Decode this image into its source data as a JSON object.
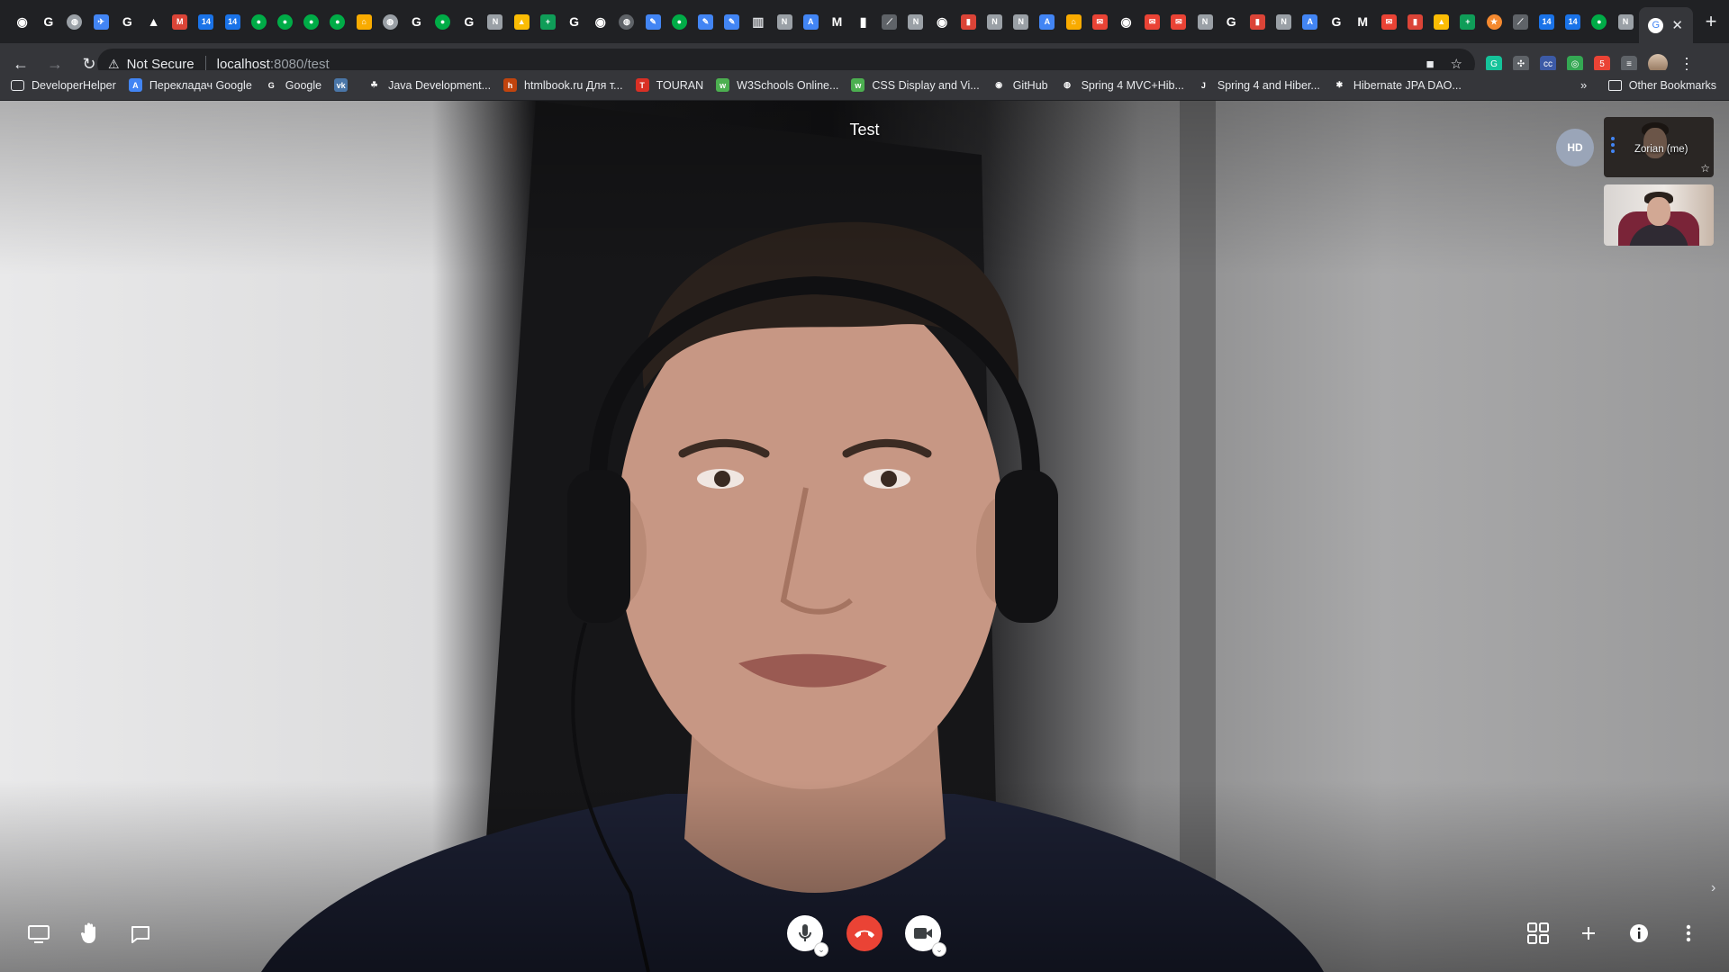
{
  "browser": {
    "tabs": [
      {
        "icon": "github-icon",
        "color": "#ffffff",
        "glyph": "◉"
      },
      {
        "icon": "google-icon",
        "color": "#ffffff",
        "glyph": "G"
      },
      {
        "icon": "globe-icon",
        "color": "#9aa0a6",
        "glyph": "◍"
      },
      {
        "icon": "bird-icon",
        "color": "#4285f4",
        "glyph": "✈"
      },
      {
        "icon": "google-icon",
        "color": "#ffffff",
        "glyph": "G"
      },
      {
        "icon": "flask-icon",
        "color": "#ffffff",
        "glyph": "▲"
      },
      {
        "icon": "app-icon",
        "color": "#db4437",
        "glyph": "M"
      },
      {
        "icon": "calendar-icon",
        "color": "#1a73e8",
        "glyph": "14"
      },
      {
        "icon": "calendar-icon",
        "color": "#1a73e8",
        "glyph": "14"
      },
      {
        "icon": "chat-icon",
        "color": "#00ac47",
        "glyph": "●"
      },
      {
        "icon": "chat-icon",
        "color": "#00ac47",
        "glyph": "●"
      },
      {
        "icon": "chat-icon",
        "color": "#00ac47",
        "glyph": "●"
      },
      {
        "icon": "chat-icon",
        "color": "#00ac47",
        "glyph": "●"
      },
      {
        "icon": "bridge-icon",
        "color": "#f9ab00",
        "glyph": "⌂"
      },
      {
        "icon": "globe-icon",
        "color": "#9aa0a6",
        "glyph": "◍"
      },
      {
        "icon": "google-icon",
        "color": "#ffffff",
        "glyph": "G"
      },
      {
        "icon": "chat-icon",
        "color": "#00ac47",
        "glyph": "●"
      },
      {
        "icon": "google-icon",
        "color": "#ffffff",
        "glyph": "G"
      },
      {
        "icon": "notion-icon",
        "color": "#9aa0a6",
        "glyph": "N"
      },
      {
        "icon": "drive-icon",
        "color": "#fbbc04",
        "glyph": "▲"
      },
      {
        "icon": "sheets-icon",
        "color": "#0f9d58",
        "glyph": "+"
      },
      {
        "icon": "google-icon",
        "color": "#ffffff",
        "glyph": "G"
      },
      {
        "icon": "github-icon",
        "color": "#ffffff",
        "glyph": "◉"
      },
      {
        "icon": "globe-icon",
        "color": "#5f6368",
        "glyph": "◍"
      },
      {
        "icon": "edit-icon",
        "color": "#4285f4",
        "glyph": "✎"
      },
      {
        "icon": "chat-icon",
        "color": "#00ac47",
        "glyph": "●"
      },
      {
        "icon": "edit-icon",
        "color": "#4285f4",
        "glyph": "✎"
      },
      {
        "icon": "edit-icon",
        "color": "#4285f4",
        "glyph": "✎"
      },
      {
        "icon": "trash-icon",
        "color": "#dadce0",
        "glyph": "▥"
      },
      {
        "icon": "notion-icon",
        "color": "#9aa0a6",
        "glyph": "N"
      },
      {
        "icon": "translate-icon",
        "color": "#4285f4",
        "glyph": "A"
      },
      {
        "icon": "medium-icon",
        "color": "#ffffff",
        "glyph": "M"
      },
      {
        "icon": "app-icon",
        "color": "#ffffff",
        "glyph": "▮"
      },
      {
        "icon": "feather-icon",
        "color": "#5f6368",
        "glyph": "⟋"
      },
      {
        "icon": "notion-icon",
        "color": "#9aa0a6",
        "glyph": "N"
      },
      {
        "icon": "github-icon",
        "color": "#ffffff",
        "glyph": "◉"
      },
      {
        "icon": "app-icon",
        "color": "#db4437",
        "glyph": "▮"
      },
      {
        "icon": "notion-icon",
        "color": "#9aa0a6",
        "glyph": "N"
      },
      {
        "icon": "notion-icon",
        "color": "#9aa0a6",
        "glyph": "N"
      },
      {
        "icon": "translate-icon",
        "color": "#4285f4",
        "glyph": "A"
      },
      {
        "icon": "bridge-icon",
        "color": "#f9ab00",
        "glyph": "⌂"
      },
      {
        "icon": "mail-icon",
        "color": "#ea4335",
        "glyph": "✉"
      },
      {
        "icon": "github-icon",
        "color": "#ffffff",
        "glyph": "◉"
      },
      {
        "icon": "mail-icon",
        "color": "#ea4335",
        "glyph": "✉"
      },
      {
        "icon": "mail-icon",
        "color": "#ea4335",
        "glyph": "✉"
      },
      {
        "icon": "notion-icon",
        "color": "#9aa0a6",
        "glyph": "N"
      },
      {
        "icon": "google-icon",
        "color": "#ffffff",
        "glyph": "G"
      },
      {
        "icon": "app-icon",
        "color": "#db4437",
        "glyph": "▮"
      },
      {
        "icon": "notion-icon",
        "color": "#9aa0a6",
        "glyph": "N"
      },
      {
        "icon": "translate-icon",
        "color": "#4285f4",
        "glyph": "A"
      },
      {
        "icon": "google-icon",
        "color": "#ffffff",
        "glyph": "G"
      },
      {
        "icon": "medium-icon",
        "color": "#ffffff",
        "glyph": "M"
      },
      {
        "icon": "mail-icon",
        "color": "#ea4335",
        "glyph": "✉"
      },
      {
        "icon": "app-icon",
        "color": "#db4437",
        "glyph": "▮"
      },
      {
        "icon": "drive-icon",
        "color": "#fbbc04",
        "glyph": "▲"
      },
      {
        "icon": "sheets-icon",
        "color": "#0f9d58",
        "glyph": "+"
      },
      {
        "icon": "star-badge-icon",
        "color": "#f4892f",
        "glyph": "★"
      },
      {
        "icon": "feather-icon",
        "color": "#5f6368",
        "glyph": "⟋"
      },
      {
        "icon": "calendar-icon",
        "color": "#1a73e8",
        "glyph": "14"
      },
      {
        "icon": "calendar-icon",
        "color": "#1a73e8",
        "glyph": "14"
      },
      {
        "icon": "chat-icon",
        "color": "#00ac47",
        "glyph": "●"
      },
      {
        "icon": "notion-icon",
        "color": "#9aa0a6",
        "glyph": "N"
      }
    ],
    "active_tab": {
      "icon": "google-icon",
      "close_glyph": "✕"
    },
    "new_tab_glyph": "+",
    "nav": {
      "back": "←",
      "forward": "→",
      "reload": "↻"
    },
    "security_warning": "⚠",
    "security_label": "Not Secure",
    "url_host": "localhost",
    "url_path": ":8080/test",
    "omnibox_icons": {
      "camera": "■",
      "star": "☆"
    },
    "extensions": [
      {
        "icon": "grammarly-icon",
        "color": "#15c39a",
        "glyph": "G"
      },
      {
        "icon": "extension-icon",
        "color": "#5f6368",
        "glyph": "✣"
      },
      {
        "icon": "cc-icon",
        "color": "#3c5aa6",
        "glyph": "cc"
      },
      {
        "icon": "target-icon",
        "color": "#34a853",
        "glyph": "◎"
      },
      {
        "icon": "calendar-ext-icon",
        "color": "#ea4335",
        "glyph": "5"
      },
      {
        "icon": "playlist-icon",
        "color": "#5f6368",
        "glyph": "≡"
      }
    ],
    "menu_glyph": "⋮"
  },
  "bookmarks": [
    {
      "label": "DeveloperHelper",
      "icon": "folder-icon",
      "color": "#35363a",
      "glyph": ""
    },
    {
      "label": "Перекладач Google",
      "icon": "translate-icon",
      "color": "#4285f4",
      "glyph": "A"
    },
    {
      "label": "Google",
      "icon": "google-icon",
      "color": "#35363a",
      "glyph": "G"
    },
    {
      "label": "",
      "icon": "vk-icon",
      "color": "#4a76a8",
      "glyph": "vk"
    },
    {
      "label": "Java Development...",
      "icon": "leaf-icon",
      "color": "#35363a",
      "glyph": "☘"
    },
    {
      "label": "htmlbook.ru Для т...",
      "icon": "htmlbook-icon",
      "color": "#c1440e",
      "glyph": "h"
    },
    {
      "label": "TOURAN",
      "icon": "touran-icon",
      "color": "#d93025",
      "glyph": "T"
    },
    {
      "label": "W3Schools Online...",
      "icon": "w3schools-icon",
      "color": "#4caf50",
      "glyph": "w"
    },
    {
      "label": "CSS Display and Vi...",
      "icon": "w3schools-icon",
      "color": "#4caf50",
      "glyph": "w"
    },
    {
      "label": "GitHub",
      "icon": "github-icon",
      "color": "#35363a",
      "glyph": "◉"
    },
    {
      "label": "Spring 4 MVC+Hib...",
      "icon": "globe-icon",
      "color": "#35363a",
      "glyph": "◍"
    },
    {
      "label": "Spring 4 and Hiber...",
      "icon": "java-icon",
      "color": "#35363a",
      "glyph": "J"
    },
    {
      "label": "Hibernate JPA DAO...",
      "icon": "hibernate-icon",
      "color": "#35363a",
      "glyph": "✱"
    }
  ],
  "bookmarks_more": "»",
  "other_bookmarks": "Other Bookmarks",
  "meeting": {
    "title": "Test",
    "quality_badge": "HD",
    "self_label": "Zorian (me)",
    "pin_glyph": "☆",
    "next_glyph": "›"
  },
  "controls": {
    "left": [
      {
        "name": "present-screen-icon"
      },
      {
        "name": "raise-hand-icon"
      },
      {
        "name": "chat-icon"
      }
    ],
    "right": [
      {
        "name": "grid-layout-icon"
      },
      {
        "name": "add-icon"
      },
      {
        "name": "info-icon"
      },
      {
        "name": "more-options-icon"
      }
    ],
    "mic_dropdown_glyph": "⌄",
    "cam_dropdown_glyph": "⌄"
  },
  "colors": {
    "hangup": "#ea4335",
    "self_dots": "#4285f4",
    "hd_badge": "#9aa5b8"
  }
}
